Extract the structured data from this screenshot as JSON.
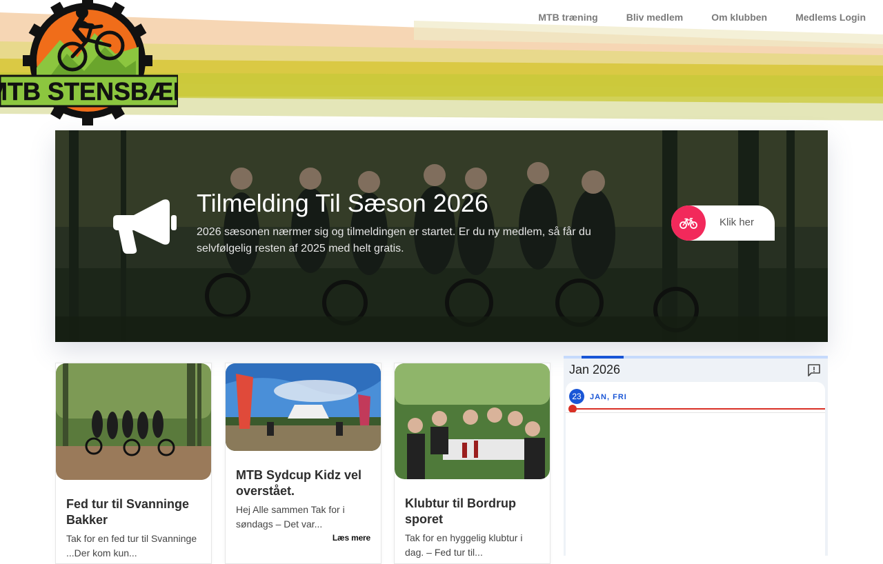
{
  "site": {
    "logo_text": "MTB STENSBÆK"
  },
  "nav": {
    "items": [
      {
        "label": "MTB træning"
      },
      {
        "label": "Bliv medlem"
      },
      {
        "label": "Om klubben"
      },
      {
        "label": "Medlems Login"
      }
    ]
  },
  "hero": {
    "title": "Tilmelding Til Sæson 2026",
    "text": "2026 sæsonen nærmer sig og tilmeldingen er startet. Er du ny medlem, så får du selvfølgelig resten af 2025 med helt gratis.",
    "cta_label": "Klik her",
    "cta_icon": "bicycle-icon",
    "icon": "megaphone-icon"
  },
  "posts": [
    {
      "title": "Fed tur til Svanninge Bakker",
      "excerpt": "Tak for en fed tur til Svanninge ...Der kom kun..."
    },
    {
      "title": "MTB Sydcup Kidz vel overstået.",
      "excerpt": "Hej Alle sammen Tak for i søndags – Det var...",
      "more_label": "Læs mere"
    },
    {
      "title": "Klubtur til Bordrup sporet",
      "excerpt": "Tak for en hyggelig klubtur i dag. – Fed tur til..."
    }
  ],
  "calendar": {
    "month": "Jan 2026",
    "day_number": "23",
    "day_label": "JAN, FRI",
    "feedback_icon": "feedback-icon"
  },
  "colors": {
    "accent_pink": "#f2295b",
    "calendar_blue": "#1a56d6",
    "now_line_red": "#d93025"
  }
}
